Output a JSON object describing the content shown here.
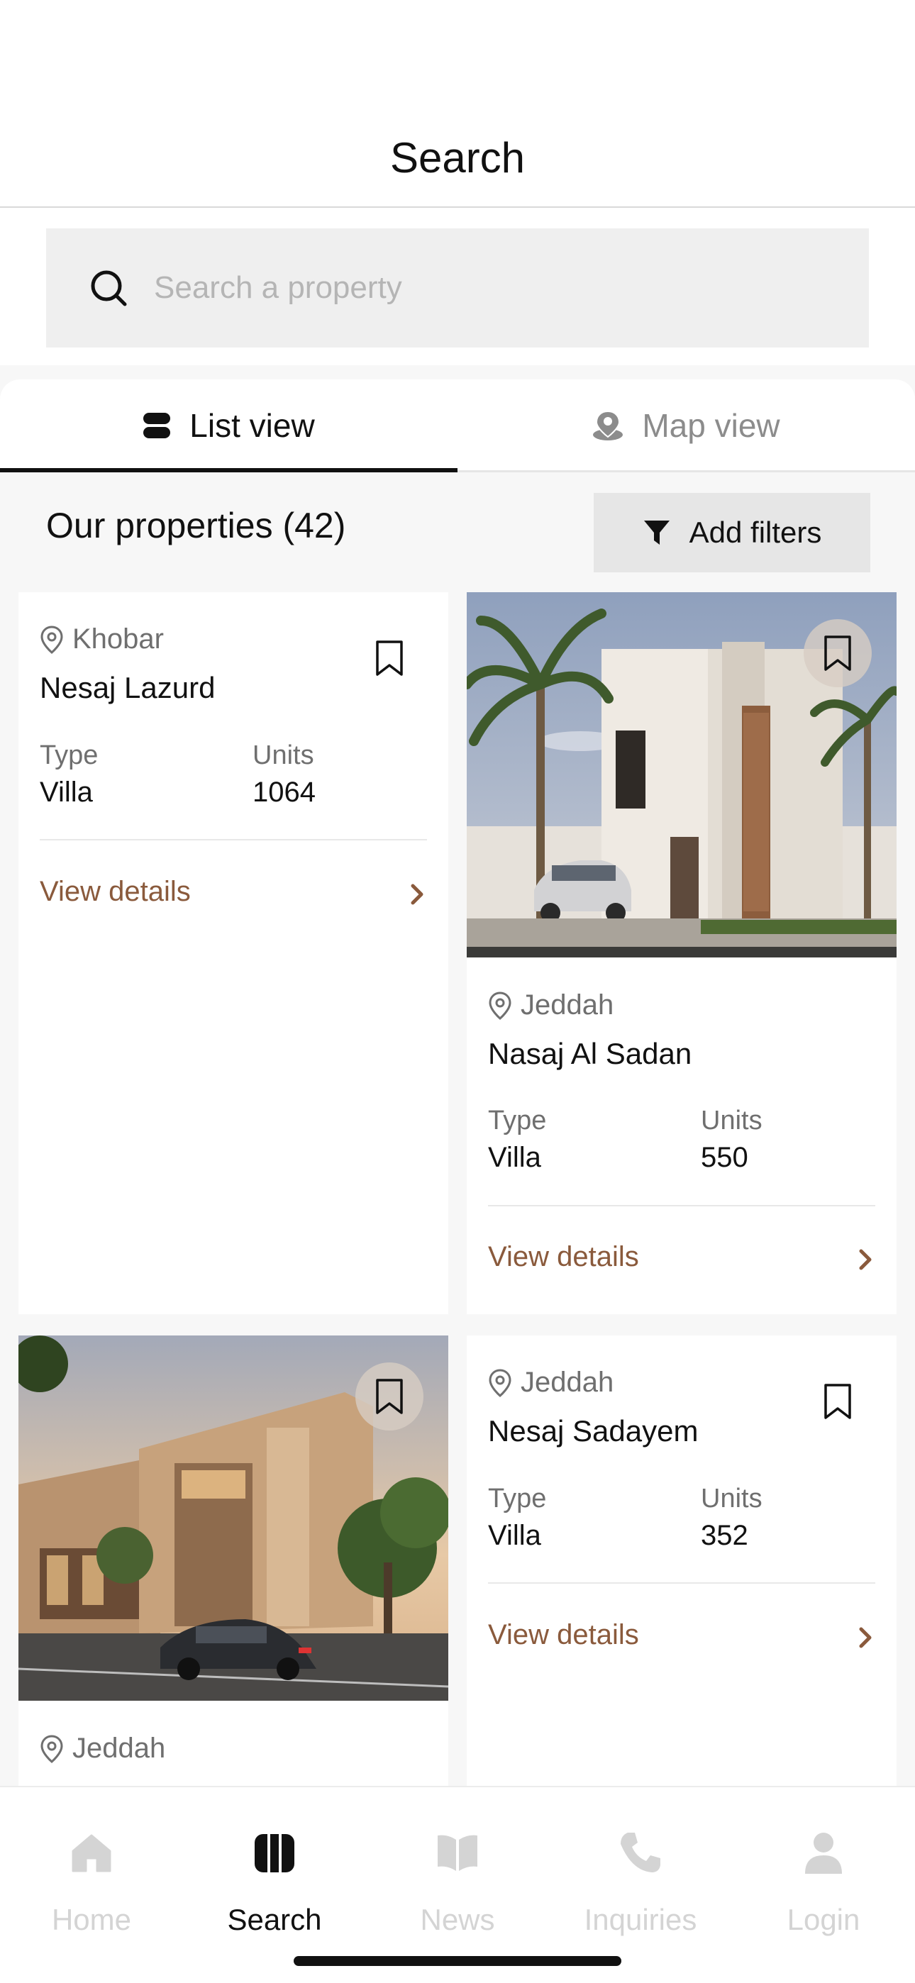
{
  "header": {
    "title": "Search"
  },
  "search": {
    "placeholder": "Search a property",
    "icon": "search-icon"
  },
  "tabs": [
    {
      "label": "List view",
      "icon": "list-view-icon",
      "active": true
    },
    {
      "label": "Map view",
      "icon": "map-pin-icon",
      "active": false
    }
  ],
  "properties": {
    "title": "Our properties (42)",
    "filter_label": "Add filters",
    "type_label": "Type",
    "units_label": "Units",
    "details_label": "View details",
    "cards": [
      {
        "location": "Khobar",
        "name": "Nesaj Lazurd",
        "type": "Villa",
        "units": "1064"
      },
      {
        "location": "Jeddah",
        "name": "Nasaj Al Sadan",
        "type": "Villa",
        "units": "550"
      },
      {
        "location": "Jeddah",
        "name": "Nesaj Sadayem",
        "type": "Villa",
        "units": "352"
      },
      {
        "location": "Jeddah"
      }
    ]
  },
  "nav": [
    {
      "label": "Home",
      "icon": "home-icon",
      "active": false
    },
    {
      "label": "Search",
      "icon": "search-nav-icon",
      "active": true
    },
    {
      "label": "News",
      "icon": "news-icon",
      "active": false
    },
    {
      "label": "Inquiries",
      "icon": "phone-icon",
      "active": false
    },
    {
      "label": "Login",
      "icon": "user-icon",
      "active": false
    }
  ],
  "colors": {
    "accent": "#8a5a3c",
    "text": "#111111",
    "muted": "#6f6f6f",
    "inactive_nav": "#d4d4d4",
    "search_bg": "#efefef"
  }
}
